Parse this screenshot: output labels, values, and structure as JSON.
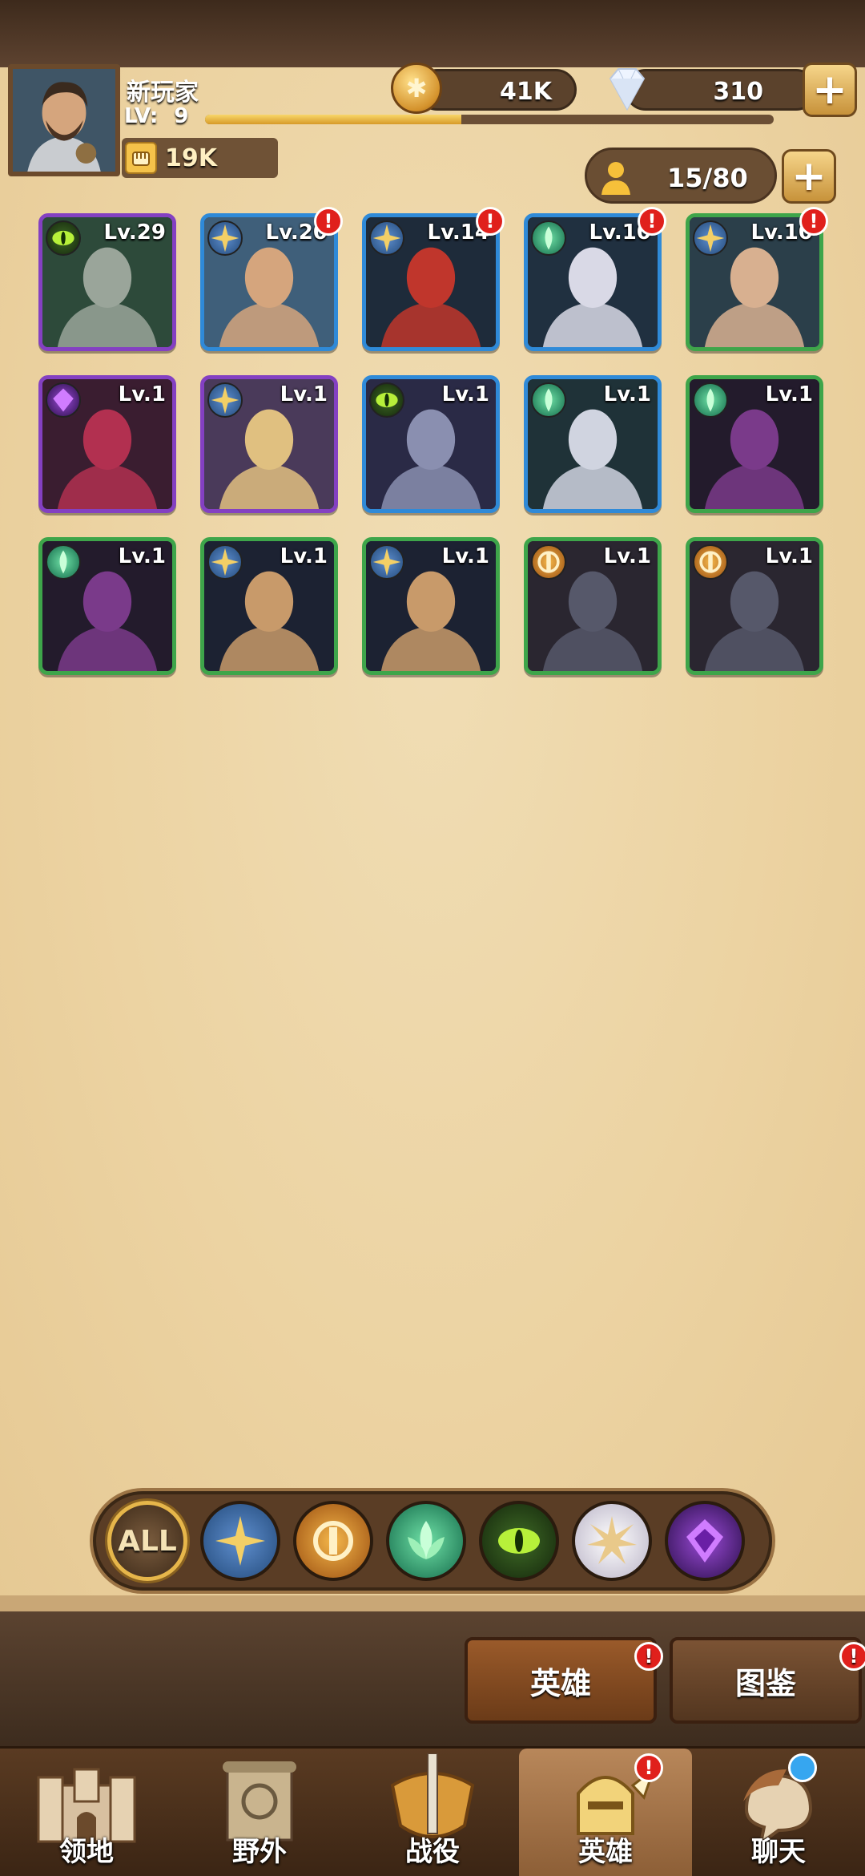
{
  "player": {
    "name": "新玩家",
    "level_label": "LV:",
    "level": "9",
    "xp_progress": 0.45,
    "power": "19K"
  },
  "currencies": {
    "gold": "41K",
    "gems": "310"
  },
  "hero_capacity": "15/80",
  "heroes": [
    {
      "level": "Lv.29",
      "faction": "eye",
      "rarity": "purple",
      "alert": false
    },
    {
      "level": "Lv.20",
      "faction": "star",
      "rarity": "blue",
      "alert": true
    },
    {
      "level": "Lv.14",
      "faction": "star",
      "rarity": "blue",
      "alert": true
    },
    {
      "level": "Lv.10",
      "faction": "leaf",
      "rarity": "blue",
      "alert": true
    },
    {
      "level": "Lv.10",
      "faction": "star",
      "rarity": "green",
      "alert": true
    },
    {
      "level": "Lv.1",
      "faction": "shadow",
      "rarity": "purple",
      "alert": false
    },
    {
      "level": "Lv.1",
      "faction": "star",
      "rarity": "purple",
      "alert": false
    },
    {
      "level": "Lv.1",
      "faction": "eye",
      "rarity": "blue",
      "alert": false
    },
    {
      "level": "Lv.1",
      "faction": "leaf",
      "rarity": "blue",
      "alert": false
    },
    {
      "level": "Lv.1",
      "faction": "leaf",
      "rarity": "green",
      "alert": false
    },
    {
      "level": "Lv.1",
      "faction": "leaf",
      "rarity": "green",
      "alert": false
    },
    {
      "level": "Lv.1",
      "faction": "star",
      "rarity": "green",
      "alert": false
    },
    {
      "level": "Lv.1",
      "faction": "star",
      "rarity": "green",
      "alert": false
    },
    {
      "level": "Lv.1",
      "faction": "fortress",
      "rarity": "green",
      "alert": false
    },
    {
      "level": "Lv.1",
      "faction": "fortress",
      "rarity": "green",
      "alert": false
    }
  ],
  "filters": {
    "all_label": "ALL",
    "factions": [
      "star",
      "fortress",
      "leaf",
      "eye",
      "light",
      "shadow"
    ]
  },
  "subtabs": {
    "heroes": "英雄",
    "codex": "图鉴"
  },
  "alert_mark": "!",
  "nav": [
    {
      "label": "领地",
      "icon": "castle-icon"
    },
    {
      "label": "野外",
      "icon": "map-scroll-icon"
    },
    {
      "label": "战役",
      "icon": "sword-shield-icon"
    },
    {
      "label": "英雄",
      "icon": "helmet-icon"
    },
    {
      "label": "聊天",
      "icon": "chat-icon"
    }
  ],
  "colors": {
    "purple_frame": "#8440c2",
    "blue_frame": "#2f8ad8",
    "green_frame": "#3ea54a",
    "alert": "#e0201c",
    "parchment": "#ecd6a8"
  }
}
